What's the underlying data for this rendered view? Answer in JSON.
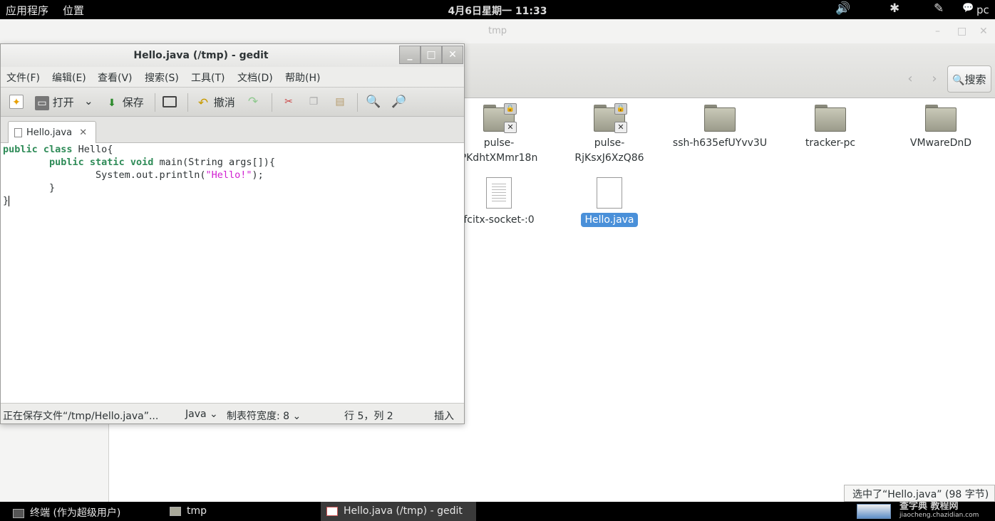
{
  "top_panel": {
    "apps_menu": "应用程序",
    "places_menu": "位置",
    "clock": "4月6日星期一 11:33",
    "volume_icon": "🔊",
    "bluetooth_icon": "✱",
    "accessibility_icon": "✎",
    "user_icon": "💬",
    "user": "pc"
  },
  "nautilus": {
    "title": "tmp",
    "window_controls": {
      "minimize": "–",
      "maximize": "□",
      "close": "✕"
    },
    "nav": {
      "back": "‹",
      "forward": "›"
    },
    "search_label": "搜索",
    "files": [
      {
        "name": "pulse-",
        "name2": "PKdhtXMmr18n",
        "kind": "folder-locked"
      },
      {
        "name": "pulse-",
        "name2": "RjKsxJ6XzQ86",
        "kind": "folder-locked"
      },
      {
        "name": "ssh-h635efUYvv3U",
        "name2": "",
        "kind": "folder"
      },
      {
        "name": "tracker-pc",
        "name2": "",
        "kind": "folder"
      },
      {
        "name": "VMwareDnD",
        "name2": "",
        "kind": "folder"
      },
      {
        "name": "fcitx-socket-:0",
        "name2": "",
        "kind": "file"
      },
      {
        "name": "Hello.java",
        "name2": "",
        "kind": "file",
        "selected": true
      }
    ]
  },
  "gedit": {
    "title": "Hello.java (/tmp) - gedit",
    "wc": {
      "min": "_",
      "max": "□",
      "close": "✕"
    },
    "menu": [
      "文件(F)",
      "编辑(E)",
      "查看(V)",
      "搜索(S)",
      "工具(T)",
      "文档(D)",
      "帮助(H)"
    ],
    "toolbar": {
      "open": "打开",
      "save": "保存",
      "undo": "撤消"
    },
    "tab": {
      "label": "Hello.java",
      "close": "✕"
    },
    "code": {
      "l1_kw": "public class",
      "l1_rest": " Hello{",
      "l2_indent": "        ",
      "l2_kw": "public static void",
      "l2_rest": " main(String args[]){",
      "l3_pre": "                System.out.println(",
      "l3_str": "\"Hello!\"",
      "l3_post": ");",
      "l4": "        }",
      "l5": "}"
    },
    "status": {
      "message": "正在保存文件“/tmp/Hello.java”...",
      "language": "Java",
      "tab_width": "制表符宽度:  8",
      "position": "行 5，列 2",
      "mode": "插入"
    }
  },
  "notification": "选中了“Hello.java” (98 字节)",
  "taskbar": {
    "items": [
      {
        "label": "终端 (作为超级用户)"
      },
      {
        "label": "tmp"
      },
      {
        "label": "Hello.java (/tmp) - gedit",
        "active": true
      }
    ],
    "watermark_1": "查字典 教程网",
    "watermark_2": "jiaocheng.chazidian.com"
  }
}
